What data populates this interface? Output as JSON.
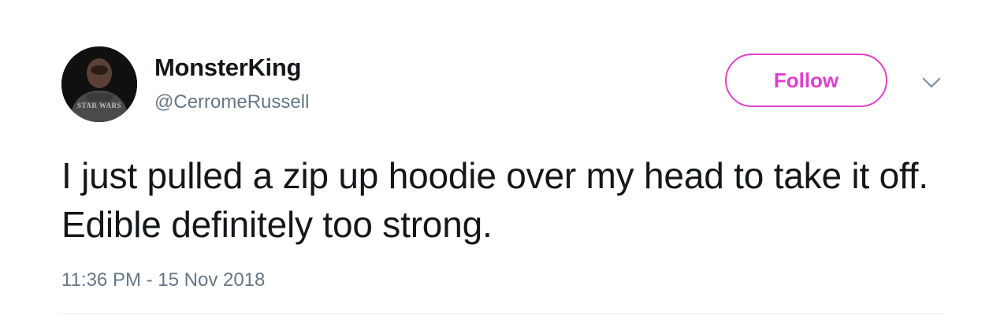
{
  "tweet": {
    "author": {
      "display_name": "MonsterKing",
      "handle": "@CerromeRussell",
      "avatar_icon": "profile-photo",
      "avatar_shirt_text": "STAR WARS"
    },
    "follow_label": "Follow",
    "menu_icon": "chevron-down-icon",
    "text": "I just pulled a zip up hoodie over my head to take it off. Edible definitely too strong.",
    "timestamp": "11:36 PM - 15 Nov 2018"
  },
  "colors": {
    "accent": "#e040c8",
    "text": "#14171a",
    "secondary_text": "#657786",
    "divider": "#e6ecf0"
  }
}
